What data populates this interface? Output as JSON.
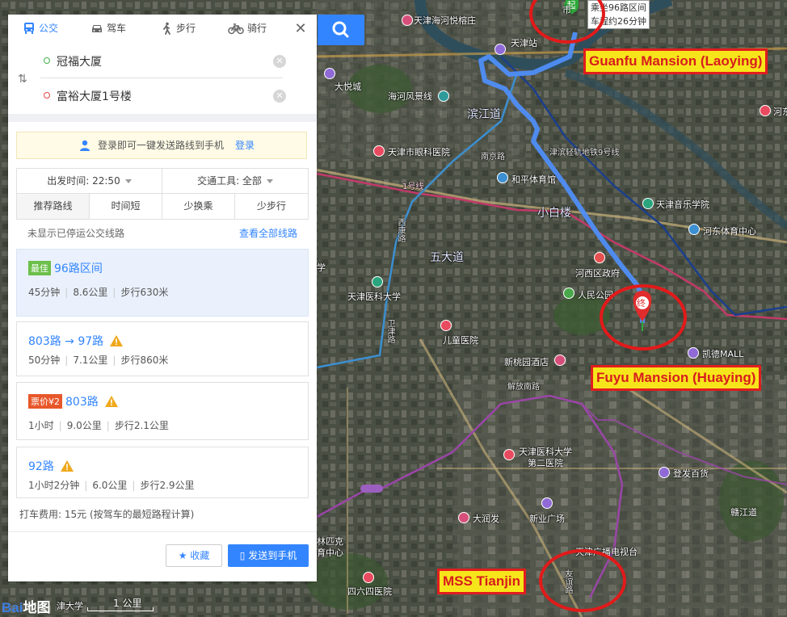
{
  "map": {
    "labels": {
      "haihe_hotel": "天津海河悦榕庄",
      "tianjin_station": "天津站",
      "dayuecheng": "大悦城",
      "haihe_scenic": "海河风景线",
      "binjiang": "滨江道",
      "eye_hospital": "天津市眼科医院",
      "metro9": "津滨轻轨地铁9号线",
      "heping_stadium": "和平体育馆",
      "music_college": "天津音乐学院",
      "line1": "1号线",
      "xiaobailou": "小白楼",
      "hebei_sports": "河东体育中心",
      "wudadao": "五大道",
      "hexi_gov": "河西区政府",
      "medical_univ": "天津医科大学",
      "peoples_park": "人民公园",
      "childrens_hospital": "儿童医院",
      "kaide_mall": "凯德MALL",
      "xintaoyuan_hotel": "新桃园酒店",
      "tmu_second": "天津医科大学第二医院",
      "dengfa": "登发百货",
      "darunfa": "大润发",
      "xinye": "新业广场",
      "tv_tower": "天津广播电视台",
      "hospital464": "四六四医院",
      "school_partial": "学",
      "ganjiang": "赣江道",
      "hedong_partial": "河东",
      "sports_partial": "育中心",
      "olympic_partial": "林匹克",
      "tianjin_partial": "津大学",
      "shi_partial": "市",
      "weijin_rd": "卫津路",
      "xikang": "西康路",
      "nanjing": "南京路",
      "youyi": "友谊路",
      "jiefang": "解放南路"
    },
    "route_tip": {
      "line1": "乘坐96路区间",
      "line2": "车程约26分钟"
    },
    "start_marker": "起",
    "end_marker": "终",
    "annotations": {
      "guanfu": "Guanfu Mansion (Laoying)",
      "fuyu": "Fuyu Mansion (Huaying)",
      "mss": "MSS Tianjin"
    },
    "logo_text": "Bai",
    "logo_text2": "地图",
    "scale_label": "1 公里"
  },
  "panel": {
    "modes": [
      {
        "label": "公交",
        "icon": "bus-icon",
        "active": true
      },
      {
        "label": "驾车",
        "icon": "car-icon"
      },
      {
        "label": "步行",
        "icon": "walk-icon"
      },
      {
        "label": "骑行",
        "icon": "bike-icon"
      }
    ],
    "start": "冠福大厦",
    "end": "富裕大厦1号楼",
    "login_text": "登录即可一键发送路线到手机",
    "login_link": "登录",
    "depart": "出发时间: 22:50",
    "vehicle": "交通工具: 全部",
    "sorts": [
      "推荐路线",
      "时间短",
      "少换乘",
      "少步行"
    ],
    "stopped_text": "未显示已停运公交线路",
    "view_all": "查看全部线路",
    "routes": [
      {
        "tag": "最佳",
        "title": "96路区间",
        "time": "45分钟",
        "dist": "8.6公里",
        "walk": "步行630米"
      },
      {
        "title": "803路 → 97路",
        "time": "50分钟",
        "dist": "7.1公里",
        "walk": "步行860米"
      },
      {
        "tag": "票价¥2",
        "title": "803路",
        "time": "1小时",
        "dist": "9.0公里",
        "walk": "步行2.1公里"
      },
      {
        "title": "92路",
        "time": "1小时2分钟",
        "dist": "6.0公里",
        "walk": "步行2.9公里"
      }
    ],
    "taxi": "打车费用: 15元 (按驾车的最短路程计算)",
    "fav_btn": "收藏",
    "send_btn": "发送到手机"
  },
  "colors": {
    "accent": "#3385ff",
    "route_line": "#4f8ef7",
    "annotation_border": "#e01e1e",
    "annotation_fill": "#f7e51b"
  }
}
